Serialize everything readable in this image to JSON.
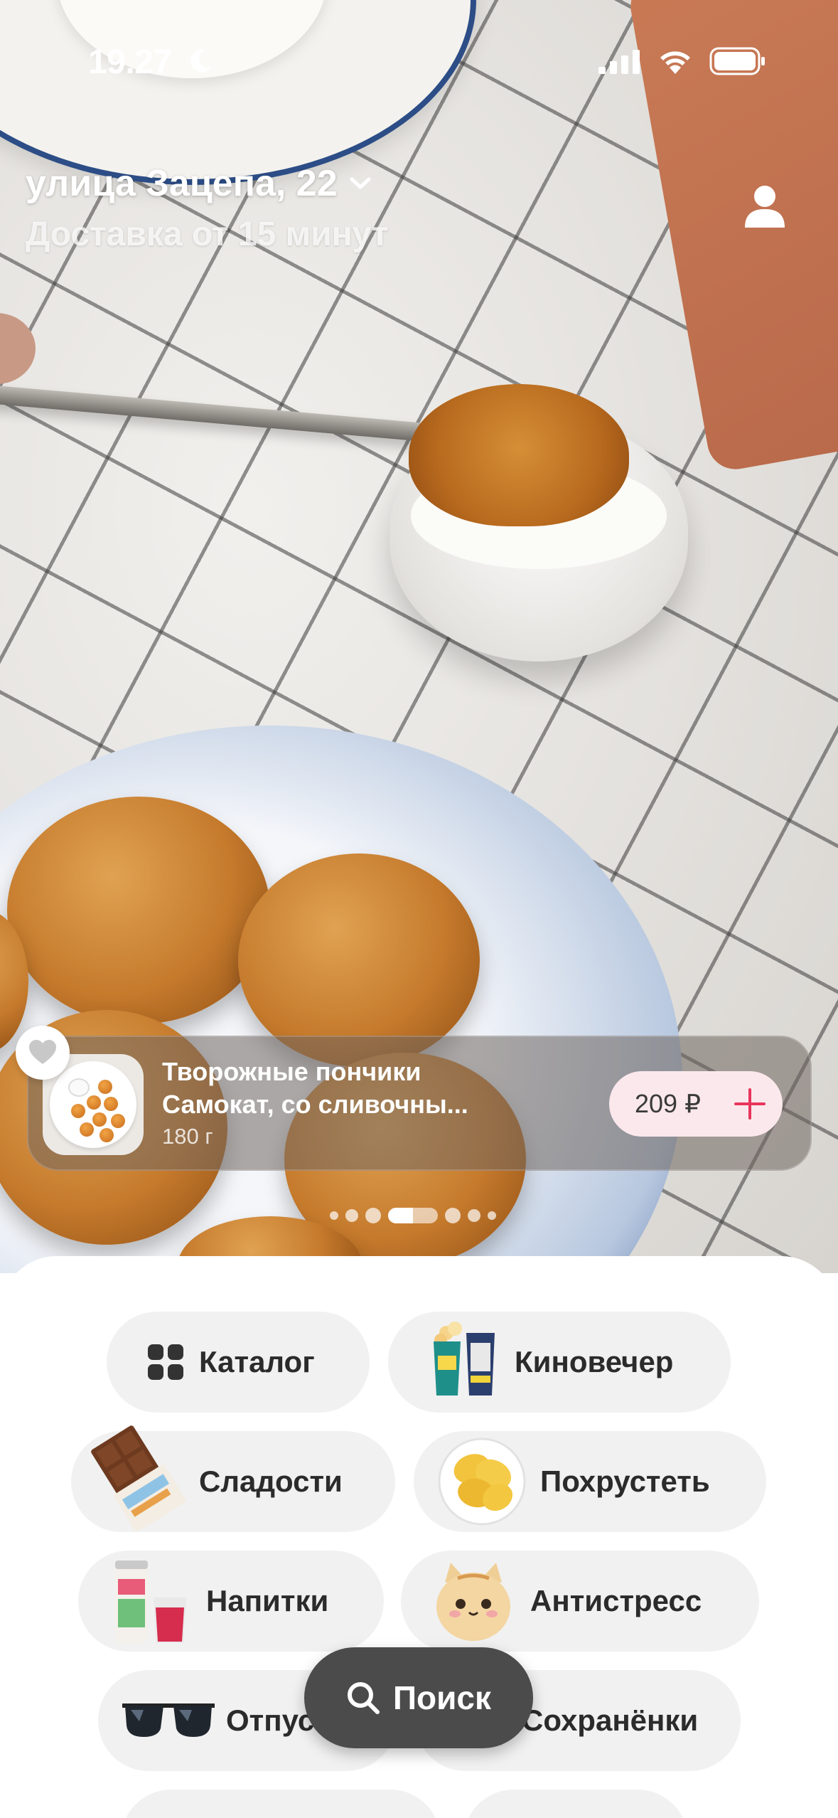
{
  "status_bar": {
    "time": "19.27",
    "icons": [
      "moon-icon",
      "signal-icon",
      "wifi-icon",
      "battery-icon"
    ]
  },
  "header": {
    "address": "улица Зацепа, 22",
    "delivery": "Доставка от 15 минут",
    "icons": [
      "chevron-down-icon",
      "profile-icon"
    ]
  },
  "product_card": {
    "title_line1": "Творожные пончики",
    "title_line2": "Самокат, со сливочны...",
    "weight": "180 г",
    "price": "209 ₽",
    "icons": [
      "heart-icon",
      "plus-icon"
    ]
  },
  "pager": {
    "count": 7,
    "active_index": 3
  },
  "categories": [
    {
      "label": "Каталог",
      "icon": "grid-icon"
    },
    {
      "label": "Киновечер",
      "icon": "popcorn-icon"
    },
    {
      "label": "Сладости",
      "icon": "chocolate-icon"
    },
    {
      "label": "Похрустеть",
      "icon": "chips-icon"
    },
    {
      "label": "Напитки",
      "icon": "drink-icon"
    },
    {
      "label": "Антистресс",
      "icon": "cat-plush-icon"
    },
    {
      "label": "Отпуск",
      "icon": "sunglasses-icon"
    },
    {
      "label": "Сохранёнки",
      "icon": "bookmark-icon"
    }
  ],
  "search": {
    "label": "Поиск",
    "icon": "search-icon"
  },
  "colors": {
    "accent": "#e8355c",
    "chip_bg": "#f1f1f1",
    "search_bg": "#4b4b4b"
  }
}
